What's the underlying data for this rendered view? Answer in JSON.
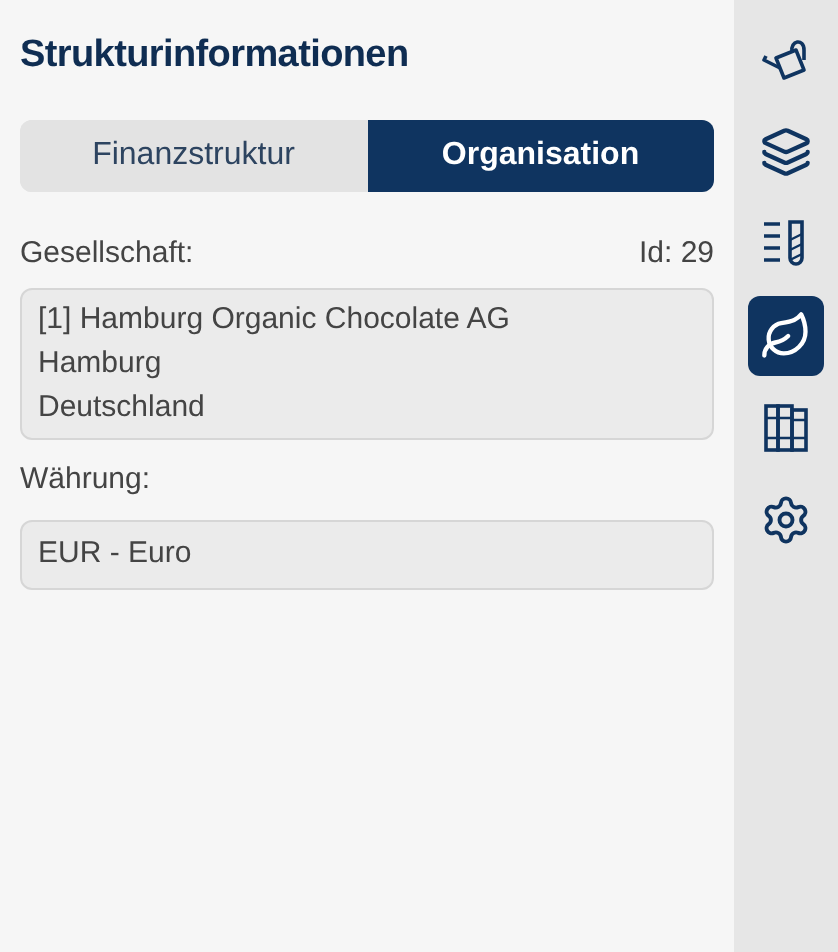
{
  "panel": {
    "title": "Strukturinformationen"
  },
  "tabs": [
    {
      "label": "Finanzstruktur",
      "selected": false
    },
    {
      "label": "Organisation",
      "selected": true
    }
  ],
  "company": {
    "label": "Gesellschaft:",
    "id": "Id: 29",
    "lines": [
      "[1] Hamburg Organic Chocolate AG",
      "Hamburg",
      "Deutschland"
    ]
  },
  "currency": {
    "label": "Währung:",
    "value": "EUR - Euro"
  },
  "sidebar": {
    "items": [
      {
        "kind": "watering-can",
        "selected": false
      },
      {
        "kind": "layers",
        "selected": false
      },
      {
        "kind": "list-tube",
        "selected": false
      },
      {
        "kind": "leaf",
        "selected": true
      },
      {
        "kind": "books",
        "selected": false
      },
      {
        "kind": "settings",
        "selected": false
      }
    ]
  }
}
